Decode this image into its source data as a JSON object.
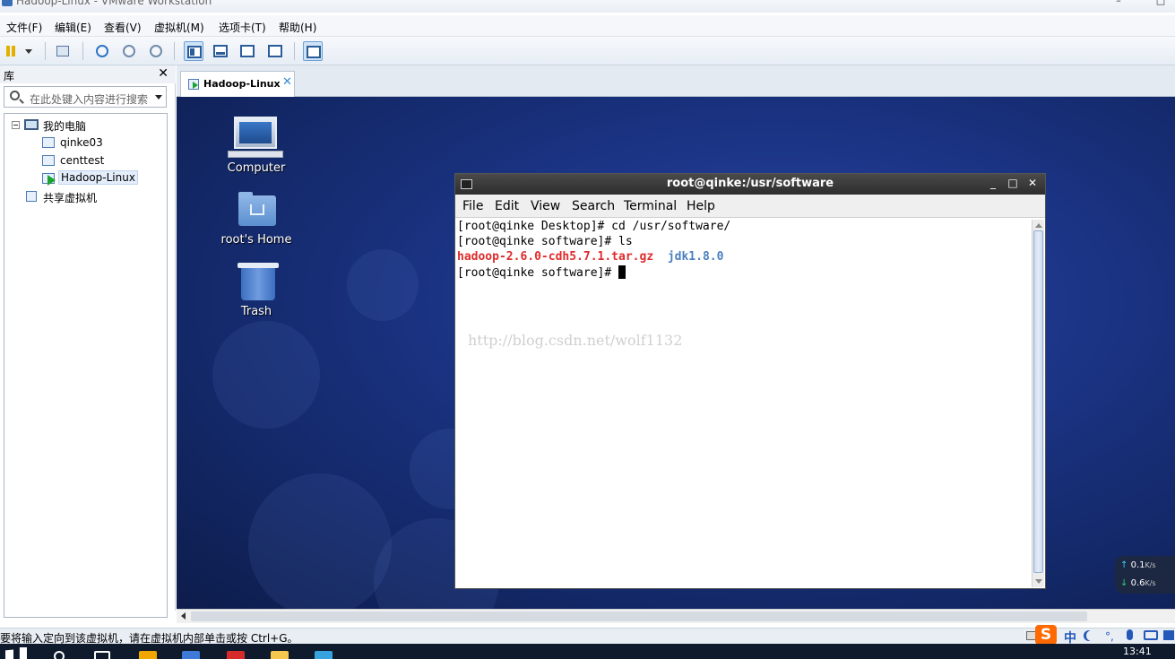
{
  "window": {
    "title": "Hadoop-Linux - VMware Workstation"
  },
  "menubar": {
    "items": [
      "文件(F)",
      "编辑(E)",
      "查看(V)",
      "虚拟机(M)",
      "选项卡(T)",
      "帮助(H)"
    ]
  },
  "library": {
    "title": "库",
    "close": "✕",
    "search_placeholder": "在此处键入内容进行搜索",
    "tree": {
      "root": "我的电脑",
      "vms": [
        "qinke03",
        "centtest",
        "Hadoop-Linux"
      ],
      "selected": "Hadoop-Linux",
      "shared": "共享虚拟机"
    }
  },
  "tab": {
    "label": "Hadoop-Linux",
    "close": "✕"
  },
  "desktop": {
    "icons": [
      "Computer",
      "root's Home",
      "Trash"
    ]
  },
  "terminal": {
    "title": "root@qinke:/usr/software",
    "menu": [
      "File",
      "Edit",
      "View",
      "Search",
      "Terminal",
      "Help"
    ],
    "lines": [
      "[root@qinke Desktop]# cd /usr/software/",
      "[root@qinke software]# ls"
    ],
    "ls_output": {
      "tar_file": "hadoop-2.6.0-cdh5.7.1.tar.gz",
      "dir": "jdk1.8.0"
    },
    "prompt": "[root@qinke software]# ",
    "watermark": "http://blog.csdn.net/wolf1132"
  },
  "net_widget": {
    "up": "0.1",
    "down": "0.6",
    "unit": "K/s"
  },
  "statusbar": {
    "message": "要将输入定向到该虚拟机，请在虚拟机内部单击或按 Ctrl+G。",
    "ime_label": "中"
  },
  "taskbar": {
    "clock": "13:41"
  }
}
